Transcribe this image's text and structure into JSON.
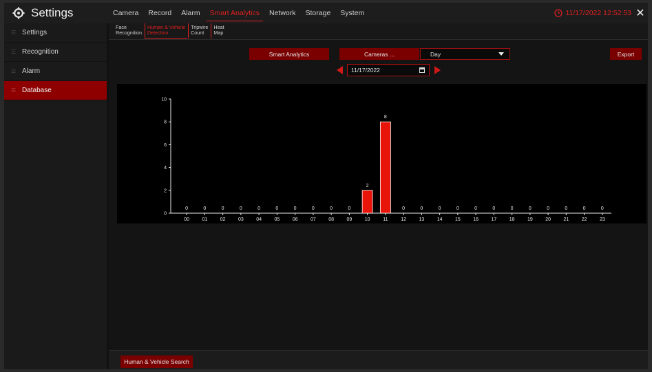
{
  "app": {
    "title": "Settings"
  },
  "nav": {
    "items": [
      {
        "label": "Camera",
        "active": false
      },
      {
        "label": "Record",
        "active": false
      },
      {
        "label": "Alarm",
        "active": false
      },
      {
        "label": "Smart Analytics",
        "active": true
      },
      {
        "label": "Network",
        "active": false
      },
      {
        "label": "Storage",
        "active": false
      },
      {
        "label": "System",
        "active": false
      }
    ]
  },
  "clock": {
    "datetime": "11/17/2022 12:52:53"
  },
  "sidebar": {
    "items": [
      {
        "label": "Settings",
        "active": false
      },
      {
        "label": "Recognition",
        "active": false
      },
      {
        "label": "Alarm",
        "active": false
      },
      {
        "label": "Database",
        "active": true
      }
    ]
  },
  "subtabs": [
    {
      "line1": "Face",
      "line2": "Recognition",
      "active": false
    },
    {
      "line1": "Human & Vehicle",
      "line2": "Detection",
      "active": true
    },
    {
      "line1": "Tripwire",
      "line2": "Count",
      "active": false
    },
    {
      "line1": "Heat",
      "line2": "Map",
      "active": false
    }
  ],
  "toolbar": {
    "smart_analytics_label": "Smart Analytics",
    "cameras_label": "Cameras ...",
    "range_value": "Day",
    "export_label": "Export",
    "date_value": "11/17/2022"
  },
  "bottom": {
    "search_label": "Human & Vehicle Search"
  },
  "colors": {
    "accent": "#e02020",
    "button": "#7a0000",
    "bar": "#e8140a"
  },
  "chart_data": {
    "type": "bar",
    "categories": [
      "00",
      "01",
      "02",
      "03",
      "04",
      "05",
      "06",
      "07",
      "08",
      "09",
      "10",
      "11",
      "12",
      "13",
      "14",
      "15",
      "16",
      "17",
      "18",
      "19",
      "20",
      "21",
      "22",
      "23"
    ],
    "values": [
      0,
      0,
      0,
      0,
      0,
      0,
      0,
      0,
      0,
      0,
      2,
      8,
      0,
      0,
      0,
      0,
      0,
      0,
      0,
      0,
      0,
      0,
      0,
      0
    ],
    "yticks": [
      "0",
      "2",
      "4",
      "6",
      "8",
      "10"
    ],
    "ylim": [
      0,
      10
    ],
    "data_labels": true,
    "grid": false
  }
}
